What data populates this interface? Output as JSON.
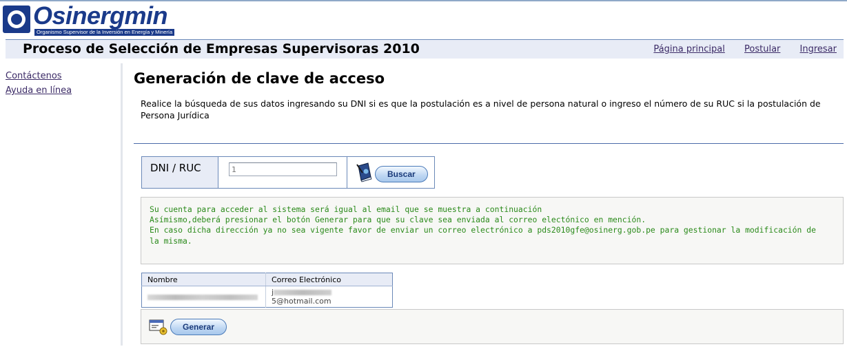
{
  "logo": {
    "name": "Osinergmin",
    "subtitle": "Organismo Supervisor de la Inversión en Energía y Minería"
  },
  "header": {
    "title": "Proceso de Selección de Empresas Supervisoras 2010",
    "links": [
      "Página principal",
      "Postular",
      "Ingresar"
    ]
  },
  "sidebar": {
    "items": [
      "Contáctenos",
      "Ayuda en línea"
    ]
  },
  "main": {
    "title": "Generación de clave de acceso",
    "description": "Realice la búsqueda de sus datos ingresando su DNI si es que la postulación es a nivel de persona natural o ingreso el número de su RUC si la postulación de Persona Jurídica",
    "search": {
      "label": "DNI / RUC",
      "value": "1",
      "button_label": "Buscar"
    },
    "info_lines": [
      "Su cuenta para acceder al sistema será igual al email que se muestra a continuación",
      "Asímismo,deberá presionar el botón Generar para que su clave sea enviada al correo electónico en mención.",
      "En caso dicha dirección ya no sea vigente favor de enviar un correo electrónico a pds2010gfe@osinerg.gob.pe para gestionar la modificación de",
      "la misma."
    ],
    "table": {
      "headers": [
        "Nombre",
        "Correo Electrónico"
      ],
      "rows": [
        {
          "email_prefix": "j",
          "email_suffix": "5@hotmail.com"
        }
      ]
    },
    "generate_button_label": "Generar"
  },
  "colors": {
    "brand_blue": "#1a3a8a",
    "header_bg": "#e8ecf6",
    "link": "#3b2a66",
    "info_text": "#2a8a1a"
  }
}
